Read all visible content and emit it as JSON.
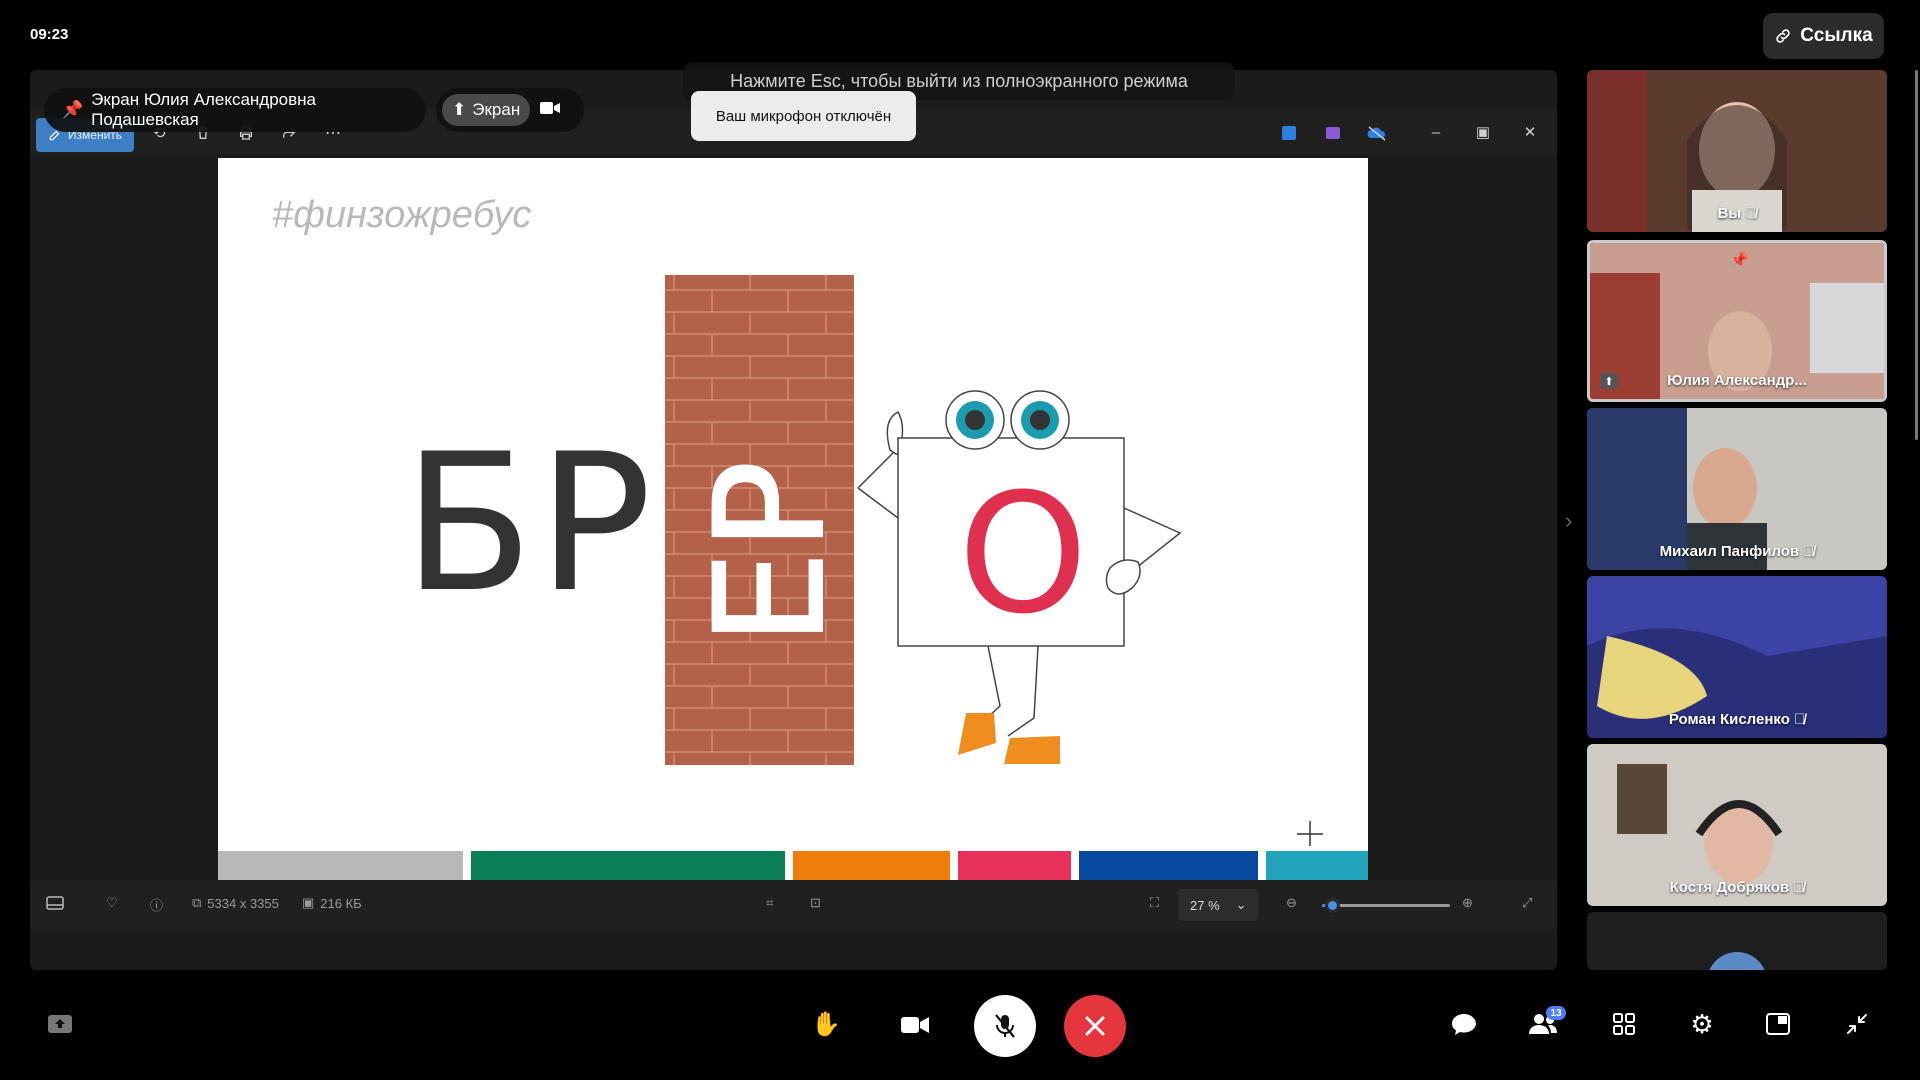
{
  "status": {
    "time": "09:23"
  },
  "header": {
    "link_label": "Ссылка"
  },
  "fullscreen_hint": "Нажмите Esc, чтобы выйти из полноэкранного режима",
  "share": {
    "screen_owner_label": "Экран Юлия Александровна Подашевская",
    "screen_chip_label": "Экран"
  },
  "toast": {
    "mic_off": "Ваш микрофон отключён"
  },
  "photos_app": {
    "edit_label": "Изменить",
    "dimensions": "5334 x 3355",
    "file_size": "216 КБ",
    "zoom": "27 %",
    "zoom_level_fraction": 0.08
  },
  "slide": {
    "hashtag": "#финзожребус",
    "letters_left": "БР",
    "letters_wall": "ЕР",
    "letter_character": "О",
    "bar_colors": [
      "#b8b8b8",
      "#0a7f57",
      "#ef7d0c",
      "#e73158",
      "#0748a0",
      "#21a3bc"
    ]
  },
  "participants": [
    {
      "name": "Вы",
      "muted": true,
      "bg": "#6b4a3a"
    },
    {
      "name": "Юлия Александр...",
      "muted": false,
      "pinned": true,
      "sharing": true,
      "bg": "#b69085"
    },
    {
      "name": "Михаил Панфилов",
      "muted": true,
      "bg": "#8c93a1"
    },
    {
      "name": "Роман Кисленко",
      "muted": true,
      "bg": "#3d47a6"
    },
    {
      "name": "Костя Добряков",
      "muted": true,
      "bg": "#8f8a85"
    }
  ],
  "controls": {
    "participants_count": "13"
  },
  "colors": {
    "accent": "#4a90e2",
    "end_call": "#e5363d",
    "brick": "#b4614a"
  }
}
